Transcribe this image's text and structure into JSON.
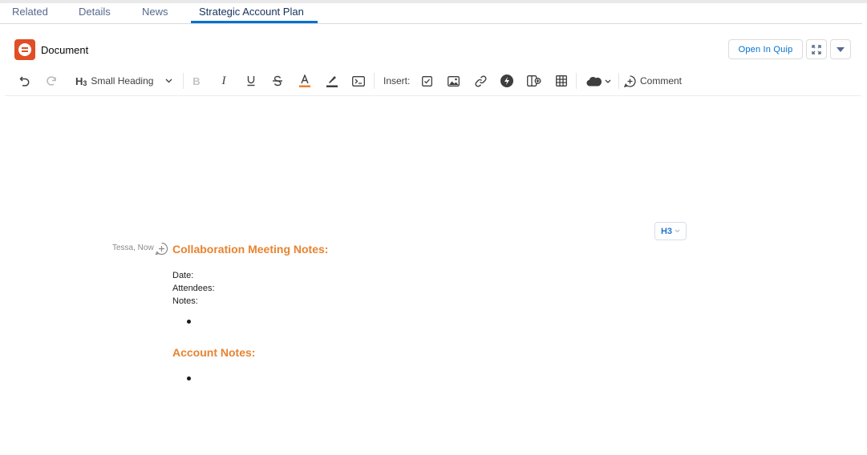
{
  "tabs": [
    {
      "label": "Related",
      "active": false
    },
    {
      "label": "Details",
      "active": false
    },
    {
      "label": "News",
      "active": false
    },
    {
      "label": "Strategic Account Plan",
      "active": true
    }
  ],
  "document": {
    "title": "Document",
    "logo_icon": "quip-logo-icon",
    "logo_color": "#e04e26",
    "open_button_label": "Open In Quip"
  },
  "toolbar": {
    "paragraph_style": "Small Heading",
    "paragraph_style_glyph": "H3",
    "insert_label": "Insert:",
    "comment_label": "Comment",
    "icons": [
      "undo-icon",
      "redo-icon",
      "bold-icon",
      "italic-icon",
      "underline-icon",
      "strikethrough-icon",
      "text-color-icon",
      "highlight-icon",
      "code-icon",
      "checklist-icon",
      "image-icon",
      "link-icon",
      "live-app-icon",
      "spreadsheet-icon",
      "table-icon",
      "salesforce-icon",
      "comment-icon"
    ],
    "text_color_accent": "#e8832f",
    "active_tab_color": "#0070d2"
  },
  "content": {
    "style_pill": "H3",
    "author": "Tessa, Now",
    "heading_color": "#e8832f",
    "heading_1": "Collaboration Meeting Notes:",
    "date_label": "Date:",
    "attendees_label": "Attendees:",
    "notes_label": "Notes:",
    "heading_2": "Account Notes:"
  }
}
